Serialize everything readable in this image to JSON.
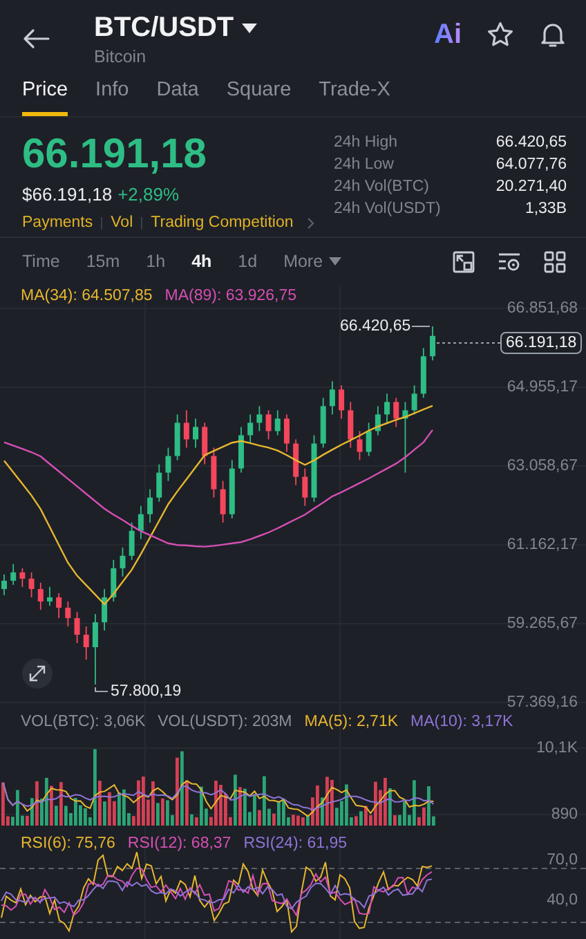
{
  "header": {
    "title": "BTC/USDT",
    "subtitle": "Bitcoin",
    "ai_label": "Ai"
  },
  "tabs": [
    {
      "label": "Price",
      "selected": true
    },
    {
      "label": "Info",
      "selected": false
    },
    {
      "label": "Data",
      "selected": false
    },
    {
      "label": "Square",
      "selected": false
    },
    {
      "label": "Trade-X",
      "selected": false
    }
  ],
  "price": {
    "last": "66.191,18",
    "usd": "$66.191,18",
    "change": "+2,89%",
    "links": [
      "Payments",
      "Vol",
      "Trading Competition"
    ]
  },
  "stats": [
    {
      "label": "24h High",
      "value": "66.420,65"
    },
    {
      "label": "24h Low",
      "value": "64.077,76"
    },
    {
      "label": "24h Vol(BTC)",
      "value": "20.271,40"
    },
    {
      "label": "24h Vol(USDT)",
      "value": "1,33B"
    }
  ],
  "intervals": [
    {
      "label": "Time",
      "selected": false
    },
    {
      "label": "15m",
      "selected": false
    },
    {
      "label": "1h",
      "selected": false
    },
    {
      "label": "4h",
      "selected": true
    },
    {
      "label": "1d",
      "selected": false
    },
    {
      "label": "More",
      "selected": false
    }
  ],
  "price_chart": {
    "chart_data": {
      "type": "candlestick",
      "grid": true,
      "categories": [
        null,
        null,
        null,
        null,
        null,
        null,
        null,
        null,
        null,
        null,
        null,
        null,
        null,
        null,
        null,
        null,
        null,
        null,
        null,
        null,
        null,
        null,
        null,
        null,
        null,
        null,
        null,
        null,
        null,
        null,
        null,
        null,
        null,
        null,
        null,
        null,
        null,
        null,
        null,
        null,
        null,
        null,
        null,
        null,
        null,
        null,
        null,
        null
      ],
      "ylim": [
        57369.16,
        66851.68
      ],
      "ohlc": [
        [
          60100,
          60450,
          59950,
          60300
        ],
        [
          60300,
          60700,
          60200,
          60500
        ],
        [
          60500,
          60600,
          60150,
          60350
        ],
        [
          60350,
          60500,
          59900,
          60100
        ],
        [
          60100,
          60250,
          59600,
          59800
        ],
        [
          59800,
          60150,
          59700,
          59900
        ],
        [
          59900,
          60000,
          59400,
          59650
        ],
        [
          59650,
          59800,
          59200,
          59400
        ],
        [
          59400,
          59550,
          58800,
          59000
        ],
        [
          59000,
          59200,
          58400,
          58700
        ],
        [
          58700,
          59500,
          57800,
          59300
        ],
        [
          59300,
          60100,
          59100,
          59900
        ],
        [
          59900,
          60800,
          59800,
          60600
        ],
        [
          60600,
          61100,
          60400,
          60900
        ],
        [
          60900,
          61700,
          60800,
          61500
        ],
        [
          61500,
          62100,
          61300,
          61900
        ],
        [
          61900,
          62500,
          61700,
          62300
        ],
        [
          62300,
          63100,
          62200,
          62900
        ],
        [
          62900,
          63500,
          62700,
          63300
        ],
        [
          63300,
          64300,
          63200,
          64100
        ],
        [
          64100,
          64400,
          63500,
          63700
        ],
        [
          63700,
          64200,
          63500,
          64000
        ],
        [
          64000,
          64100,
          63100,
          63300
        ],
        [
          63300,
          63500,
          62300,
          62500
        ],
        [
          62500,
          62700,
          61700,
          61900
        ],
        [
          61900,
          63200,
          61800,
          63000
        ],
        [
          63000,
          64000,
          62900,
          63800
        ],
        [
          63800,
          64300,
          63600,
          64100
        ],
        [
          64100,
          64500,
          63900,
          64300
        ],
        [
          64300,
          64400,
          63700,
          63900
        ],
        [
          63900,
          64400,
          63800,
          64200
        ],
        [
          64200,
          64300,
          63400,
          63600
        ],
        [
          63600,
          63700,
          62600,
          62800
        ],
        [
          62800,
          63000,
          62100,
          62300
        ],
        [
          62300,
          63800,
          62200,
          63600
        ],
        [
          63600,
          64700,
          63500,
          64500
        ],
        [
          64500,
          65100,
          64300,
          64900
        ],
        [
          64900,
          65000,
          64200,
          64400
        ],
        [
          64400,
          64600,
          63500,
          63700
        ],
        [
          63700,
          63900,
          63200,
          63400
        ],
        [
          63400,
          64100,
          63300,
          63900
        ],
        [
          63900,
          64500,
          63800,
          64300
        ],
        [
          64300,
          64800,
          64100,
          64600
        ],
        [
          64600,
          64700,
          64000,
          64200
        ],
        [
          64200,
          64600,
          62900,
          64400
        ],
        [
          64400,
          65000,
          64300,
          64800
        ],
        [
          64800,
          65900,
          64700,
          65700
        ],
        [
          65700,
          66420,
          65600,
          66190
        ]
      ],
      "yticks": [
        {
          "value": 66851.68,
          "label": "66.851,68"
        },
        {
          "value": 64955.17,
          "label": "64.955,17"
        },
        {
          "value": 63058.67,
          "label": "63.058,67"
        },
        {
          "value": 61162.17,
          "label": "61.162,17"
        },
        {
          "value": 59265.67,
          "label": "59.265,67"
        },
        {
          "value": 57369.16,
          "label": "57.369,16"
        }
      ],
      "series": [
        {
          "name": "MA(34): 64.507,85",
          "type": "line",
          "color": "#e8b72f",
          "values": [
            63190,
            62910,
            62630,
            62350,
            62020,
            61590,
            61160,
            60730,
            60420,
            60190,
            59960,
            59730,
            59980,
            60270,
            60560,
            60940,
            61340,
            61740,
            62140,
            62450,
            62740,
            63030,
            63320,
            63420,
            63520,
            63620,
            63660,
            63610,
            63550,
            63500,
            63430,
            63320,
            63200,
            63090,
            63200,
            63330,
            63450,
            63570,
            63680,
            63790,
            63910,
            64010,
            64090,
            64170,
            64240,
            64330,
            64420,
            64510
          ]
        },
        {
          "name": "MA(89): 63.926,75",
          "type": "line",
          "color": "#d64fb4",
          "values": [
            63630,
            63550,
            63470,
            63390,
            63290,
            63110,
            62930,
            62750,
            62570,
            62390,
            62210,
            62030,
            61890,
            61760,
            61620,
            61490,
            61400,
            61300,
            61200,
            61160,
            61150,
            61130,
            61120,
            61140,
            61170,
            61200,
            61230,
            61300,
            61380,
            61460,
            61560,
            61670,
            61780,
            61890,
            62040,
            62180,
            62330,
            62430,
            62540,
            62650,
            62760,
            62880,
            63000,
            63120,
            63270,
            63450,
            63630,
            63930
          ]
        }
      ]
    },
    "high_marker": "66.420,65",
    "low_marker": "57.800,19",
    "last_price": "66.191,18"
  },
  "volume_chart": {
    "legend": [
      {
        "text": "VOL(BTC): 3,06K",
        "color": "#8b909a"
      },
      {
        "text": "VOL(USDT): 203M",
        "color": "#8b909a"
      },
      {
        "text": "MA(5): 2,71K",
        "color": "#e8b72f"
      },
      {
        "text": "MA(10): 3,17K",
        "color": "#8f74d8"
      }
    ],
    "axis": [
      "10,1K",
      "890"
    ]
  },
  "rsi_chart": {
    "legend": [
      {
        "text": "RSI(6): 75,76",
        "color": "#e8b72f"
      },
      {
        "text": "RSI(12): 68,37",
        "color": "#d64fb4"
      },
      {
        "text": "RSI(24): 61,95",
        "color": "#8f74d8"
      }
    ],
    "axis": [
      "70,0",
      "40,0"
    ]
  }
}
